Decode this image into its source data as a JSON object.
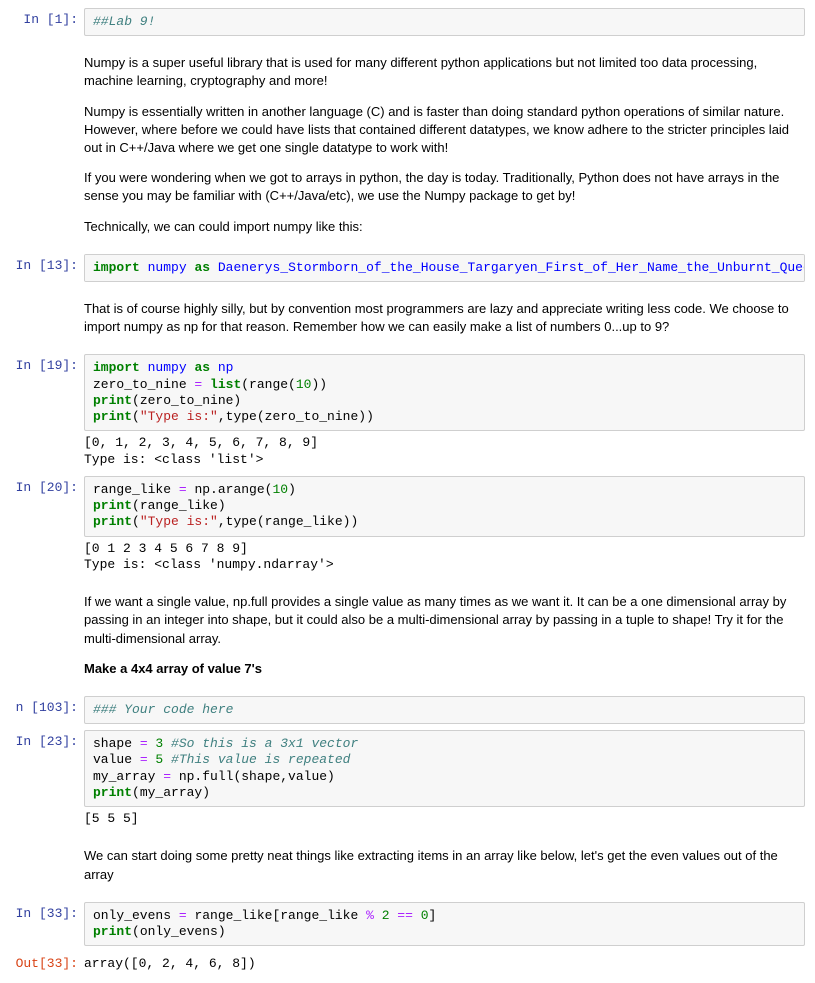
{
  "cells": {
    "c1_prompt": "In [1]:",
    "c1_code": "##Lab 9!",
    "md1_p1": "Numpy is a super useful library that is used for many different python applications but not limited too data processing, machine learning, cryptography and more!",
    "md1_p2": "Numpy is essentially written in another language (C) and is faster than doing standard python operations of similar nature. However, where before we could have lists that contained different datatypes, we know adhere to the stricter principles laid out in C++/Java where we get one single datatype to work with!",
    "md1_p3": "If you were wondering when we got to arrays in python, the day is today. Traditionally, Python does not have arrays in the sense you may be familiar with (C++/Java/etc), we use the Numpy package to get by!",
    "md1_p4": "Technically, we can could import numpy like this:",
    "c13_prompt": "In [13]:",
    "c13_kw1": "import",
    "c13_nm1": "numpy",
    "c13_kw2": "as",
    "c13_nm2": "Daenerys_Stormborn_of_the_House_Targaryen_First_of_Her_Name_the_Unburnt_Queen_of_the_Andals_and_the_First_Men_Kha",
    "md2_p1": "That is of course highly silly, but by convention most programmers are lazy and appreciate writing less code. We choose to import numpy as np for that reason. Remember how we can easily make a list of numbers 0...up to 9?",
    "c19_prompt": "In [19]:",
    "c19_l1a": "import",
    "c19_l1b": "numpy",
    "c19_l1c": "as",
    "c19_l1d": "np",
    "c19_l2a": "zero_to_nine ",
    "c19_l2b": "=",
    "c19_l2c": " list",
    "c19_l2d": "(range(",
    "c19_l2e": "10",
    "c19_l2f": "))",
    "c19_l3a": "print",
    "c19_l3b": "(zero_to_nine)",
    "c19_l4a": "print",
    "c19_l4b": "(",
    "c19_l4c": "\"Type is:\"",
    "c19_l4d": ",type(zero_to_nine))",
    "c19_out": "[0, 1, 2, 3, 4, 5, 6, 7, 8, 9]\nType is: <class 'list'>",
    "c20_prompt": "In [20]:",
    "c20_l1a": "range_like ",
    "c20_l1b": "=",
    "c20_l1c": " np.arange(",
    "c20_l1d": "10",
    "c20_l1e": ")",
    "c20_l2a": "print",
    "c20_l2b": "(range_like)",
    "c20_l3a": "print",
    "c20_l3b": "(",
    "c20_l3c": "\"Type is:\"",
    "c20_l3d": ",type(range_like))",
    "c20_out": "[0 1 2 3 4 5 6 7 8 9]\nType is: <class 'numpy.ndarray'>",
    "md3_p1": "If we want a single value, np.full provides a single value as many times as we want it. It can be a one dimensional array by passing in an integer into shape, but it could also be a multi-dimensional array by passing in a tuple to shape! Try it for the multi-dimensional array.",
    "md3_p2": "Make a 4x4 array of value 7's",
    "c103_prompt": "n [103]:",
    "c103_code": "### Your code here",
    "c23_prompt": "In [23]:",
    "c23_l1a": "shape ",
    "c23_l1b": "=",
    "c23_l1c": " 3",
    "c23_l1d": " #So this is a 3x1 vector",
    "c23_l2a": "value ",
    "c23_l2b": "=",
    "c23_l2c": " 5",
    "c23_l2d": " #This value is repeated",
    "c23_l3a": "my_array ",
    "c23_l3b": "=",
    "c23_l3c": " np.full(shape,value)",
    "c23_l4a": "print",
    "c23_l4b": "(my_array)",
    "c23_out": "[5 5 5]",
    "md4_p1": "We can start doing some pretty neat things like extracting items in an array like below, let's get the even values out of the array",
    "c33_prompt": "In [33]:",
    "c33_l1a": "only_evens ",
    "c33_l1b": "=",
    "c33_l1c": " range_like[range_like ",
    "c33_l1d": "%",
    "c33_l1e": " 2",
    "c33_l1f": " ==",
    "c33_l1g": " 0",
    "c33_l1h": "]",
    "c33_l2a": "print",
    "c33_l2b": "(only_evens)",
    "out33_prompt": "Out[33]:",
    "out33_val": "array([0, 2, 4, 6, 8])"
  }
}
